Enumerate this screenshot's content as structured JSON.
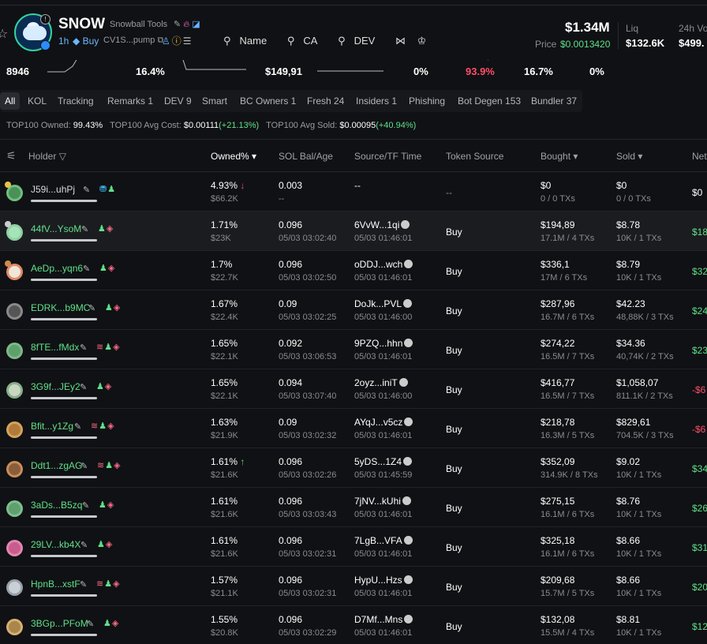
{
  "token": {
    "symbol": "SNOW",
    "name": "Snowball Tools",
    "age": "1h",
    "buy_label": "Buy",
    "ca_short": "CV1S...pump",
    "links": [
      "Name",
      "CA",
      "DEV"
    ]
  },
  "market": {
    "mcap": "$1.34M",
    "price_label": "Price",
    "price": "$0.0013420",
    "liq_label": "Liq",
    "liq": "$132.6K",
    "vol_label": "24h Vo",
    "vol": "$499."
  },
  "stats": [
    "8946",
    "16.4%",
    "$149,91",
    "0%",
    "93.9%",
    "16.7%",
    "0%"
  ],
  "colors": {
    "accent_green": "#5fe08a",
    "accent_red": "#ff4d6a",
    "accent_blue": "#69b8ff"
  },
  "tabs": [
    "All",
    "KOL",
    "Tracking",
    "Remarks 1",
    "DEV 9",
    "Smart",
    "BC Owners 1",
    "Fresh 24",
    "Insiders 1",
    "Phishing",
    "Bot Degen 153",
    "Bundler 37"
  ],
  "summary": {
    "owned_label": "TOP100 Owned:",
    "owned": "99.43%",
    "avgcost_label": "TOP100 Avg Cost:",
    "avgcost": "$0.00111",
    "avgcost_change": "(+21.13%)",
    "avgsold_label": "TOP100 Avg Sold:",
    "avgsold": "$0.00095",
    "avgsold_change": "(+40.94%)"
  },
  "columns": {
    "holder": "Holder",
    "owned": "Owned%",
    "sol": "SOL Bal/Age",
    "source": "Source/TF Time",
    "token_source": "Token Source",
    "bought": "Bought",
    "sold": "Sold",
    "net": "Net"
  },
  "rows": [
    {
      "addr": "J59i...uhPj",
      "addr_color": "#d7d8dc",
      "owned": "4.93%",
      "arrow": "↓",
      "owned_usd": "$66.2K",
      "sol": "0.003",
      "age": "--",
      "src": "--",
      "src_time": "",
      "tsrc": "--",
      "bought": "$0",
      "bought_s": "0 / 0 TXs",
      "sold": "$0",
      "sold_s": "0 / 0 TXs",
      "net": "$0",
      "net_color": "#ffffff"
    },
    {
      "addr": "44fV...YsoM",
      "addr_color": "#5fe08a",
      "owned": "1.71%",
      "arrow": "",
      "owned_usd": "$23K",
      "sol": "0.096",
      "age": "05/03 03:02:40",
      "src": "6VvW...1qi",
      "src_time": "05/03 01:46:01",
      "tsrc": "Buy",
      "bought": "$194,89",
      "bought_s": "17.1M / 4 TXs",
      "sold": "$8.78",
      "sold_s": "10K / 1 TXs",
      "net": "$18",
      "net_color": "#5fe08a"
    },
    {
      "addr": "AeDp...yqn6",
      "addr_color": "#5fe08a",
      "owned": "1.7%",
      "arrow": "",
      "owned_usd": "$22.7K",
      "sol": "0.096",
      "age": "05/03 03:02:50",
      "src": "oDDJ...wch",
      "src_time": "05/03 01:46:01",
      "tsrc": "Buy",
      "bought": "$336,1",
      "bought_s": "17M / 6 TXs",
      "sold": "$8.79",
      "sold_s": "10K / 1 TXs",
      "net": "$32",
      "net_color": "#5fe08a"
    },
    {
      "addr": "EDRK...b9MC",
      "addr_color": "#5fe08a",
      "owned": "1.67%",
      "arrow": "",
      "owned_usd": "$22.4K",
      "sol": "0.09",
      "age": "05/03 03:02:25",
      "src": "DoJk...PVL",
      "src_time": "05/03 01:46:00",
      "tsrc": "Buy",
      "bought": "$287,96",
      "bought_s": "16.7M / 6 TXs",
      "sold": "$42.23",
      "sold_s": "48,88K / 3 TXs",
      "net": "$24",
      "net_color": "#5fe08a"
    },
    {
      "addr": "8fTE...fMdx",
      "addr_color": "#5fe08a",
      "owned": "1.65%",
      "arrow": "",
      "owned_usd": "$22.1K",
      "sol": "0.092",
      "age": "05/03 03:06:53",
      "src": "9PZQ...hhn",
      "src_time": "05/03 01:46:01",
      "tsrc": "Buy",
      "bought": "$274,22",
      "bought_s": "16.5M / 7 TXs",
      "sold": "$34.36",
      "sold_s": "40,74K / 2 TXs",
      "net": "$23",
      "net_color": "#5fe08a"
    },
    {
      "addr": "3G9f...JEy2",
      "addr_color": "#5fe08a",
      "owned": "1.65%",
      "arrow": "",
      "owned_usd": "$22.1K",
      "sol": "0.094",
      "age": "05/03 03:07:40",
      "src": "2oyz...iniT",
      "src_time": "05/03 01:46:00",
      "tsrc": "Buy",
      "bought": "$416,77",
      "bought_s": "16.5M / 7 TXs",
      "sold": "$1,058,07",
      "sold_s": "811.1K / 2 TXs",
      "net": "-$6",
      "net_color": "#ff4d6a"
    },
    {
      "addr": "Bfit...y1Zg",
      "addr_color": "#5fe08a",
      "owned": "1.63%",
      "arrow": "",
      "owned_usd": "$21.9K",
      "sol": "0.09",
      "age": "05/03 03:02:32",
      "src": "AYqJ...v5cz",
      "src_time": "05/03 01:46:01",
      "tsrc": "Buy",
      "bought": "$218,78",
      "bought_s": "16.3M / 5 TXs",
      "sold": "$829,61",
      "sold_s": "704.5K / 3 TXs",
      "net": "-$6",
      "net_color": "#ff4d6a"
    },
    {
      "addr": "Ddt1...zgAG",
      "addr_color": "#5fe08a",
      "owned": "1.61%",
      "arrow": "↑",
      "owned_usd": "$21.6K",
      "sol": "0.096",
      "age": "05/03 03:02:26",
      "src": "5yDS...1Z4",
      "src_time": "05/03 01:45:59",
      "tsrc": "Buy",
      "bought": "$352,09",
      "bought_s": "314.9K / 8 TXs",
      "sold": "$9.02",
      "sold_s": "10K / 1 TXs",
      "net": "$34",
      "net_color": "#5fe08a"
    },
    {
      "addr": "3aDs...B5zq",
      "addr_color": "#5fe08a",
      "owned": "1.61%",
      "arrow": "",
      "owned_usd": "$21.6K",
      "sol": "0.096",
      "age": "05/03 03:03:43",
      "src": "7jNV...kUhi",
      "src_time": "05/03 01:46:01",
      "tsrc": "Buy",
      "bought": "$275,15",
      "bought_s": "16.1M / 6 TXs",
      "sold": "$8.76",
      "sold_s": "10K / 1 TXs",
      "net": "$26",
      "net_color": "#5fe08a"
    },
    {
      "addr": "29LV...kb4X",
      "addr_color": "#5fe08a",
      "owned": "1.61%",
      "arrow": "",
      "owned_usd": "$21.6K",
      "sol": "0.096",
      "age": "05/03 03:02:31",
      "src": "7LgB...VFA",
      "src_time": "05/03 01:46:01",
      "tsrc": "Buy",
      "bought": "$325,18",
      "bought_s": "16.1M / 6 TXs",
      "sold": "$8.66",
      "sold_s": "10K / 1 TXs",
      "net": "$31",
      "net_color": "#5fe08a"
    },
    {
      "addr": "HpnB...xstF",
      "addr_color": "#5fe08a",
      "owned": "1.57%",
      "arrow": "",
      "owned_usd": "$21.1K",
      "sol": "0.096",
      "age": "05/03 03:02:31",
      "src": "HypU...Hzs",
      "src_time": "05/03 01:46:01",
      "tsrc": "Buy",
      "bought": "$209,68",
      "bought_s": "15.7M / 5 TXs",
      "sold": "$8.66",
      "sold_s": "10K / 1 TXs",
      "net": "$20",
      "net_color": "#5fe08a"
    },
    {
      "addr": "3BGp...PFoM",
      "addr_color": "#5fe08a",
      "owned": "1.55%",
      "arrow": "",
      "owned_usd": "$20.8K",
      "sol": "0.096",
      "age": "05/03 03:02:29",
      "src": "D7Mf...Mns",
      "src_time": "05/03 01:46:01",
      "tsrc": "Buy",
      "bought": "$132,08",
      "bought_s": "15.5M / 4 TXs",
      "sold": "$8.81",
      "sold_s": "10K / 1 TXs",
      "net": "$12",
      "net_color": "#5fe08a"
    }
  ]
}
